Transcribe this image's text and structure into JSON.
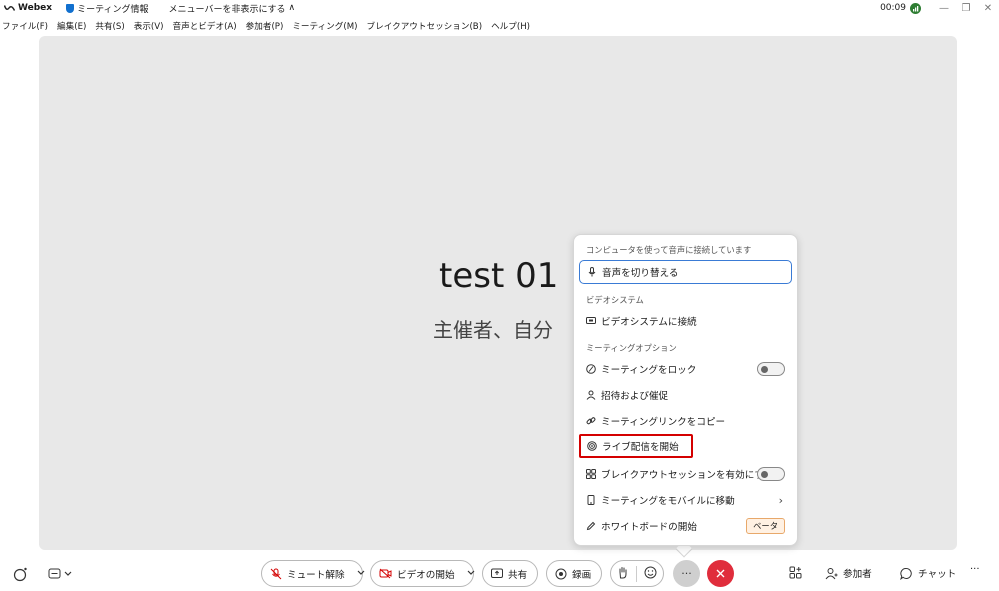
{
  "titlebar": {
    "app_name": "Webex",
    "meeting_info": "ミーティング情報",
    "hide_menubar": "メニューバーを非表示にする",
    "hide_menubar_chevron": "∧",
    "time": "00:09",
    "minimize": "—",
    "restore": "❐",
    "close": "✕"
  },
  "menubar": {
    "items": [
      "ファイル(F)",
      "編集(E)",
      "共有(S)",
      "表示(V)",
      "音声とビデオ(A)",
      "参加者(P)",
      "ミーティング(M)",
      "ブレイクアウトセッション(B)",
      "ヘルプ(H)"
    ]
  },
  "stage": {
    "meeting_title": "test 01",
    "host_label": "主催者、自分"
  },
  "popup": {
    "audio_section": "コンピュータを使って音声に接続しています",
    "switch_audio": "音声を切り替える",
    "video_section": "ビデオシステム",
    "connect_video_system": "ビデオシステムに接続",
    "meeting_options_section": "ミーティングオプション",
    "lock_meeting": "ミーティングをロック",
    "invite_remind": "招待および催促",
    "copy_meeting_link": "ミーティングリンクをコピー",
    "start_live_stream": "ライブ配信を開始",
    "enable_breakout": "ブレイクアウトセッションを有効にする",
    "move_to_mobile": "ミーティングをモバイルに移動",
    "start_whiteboard": "ホワイトボードの開始",
    "beta_label": "ベータ"
  },
  "toolbar": {
    "unmute": "ミュート解除",
    "start_video": "ビデオの開始",
    "share": "共有",
    "record": "録画",
    "more": "···",
    "participants": "参加者",
    "chat": "チャット",
    "overflow": "···"
  },
  "colors": {
    "accent_blue": "#1170cf",
    "end_call_red": "#e02d3c",
    "highlight_red": "#d40000",
    "stage_bg": "#e8e8e8"
  }
}
